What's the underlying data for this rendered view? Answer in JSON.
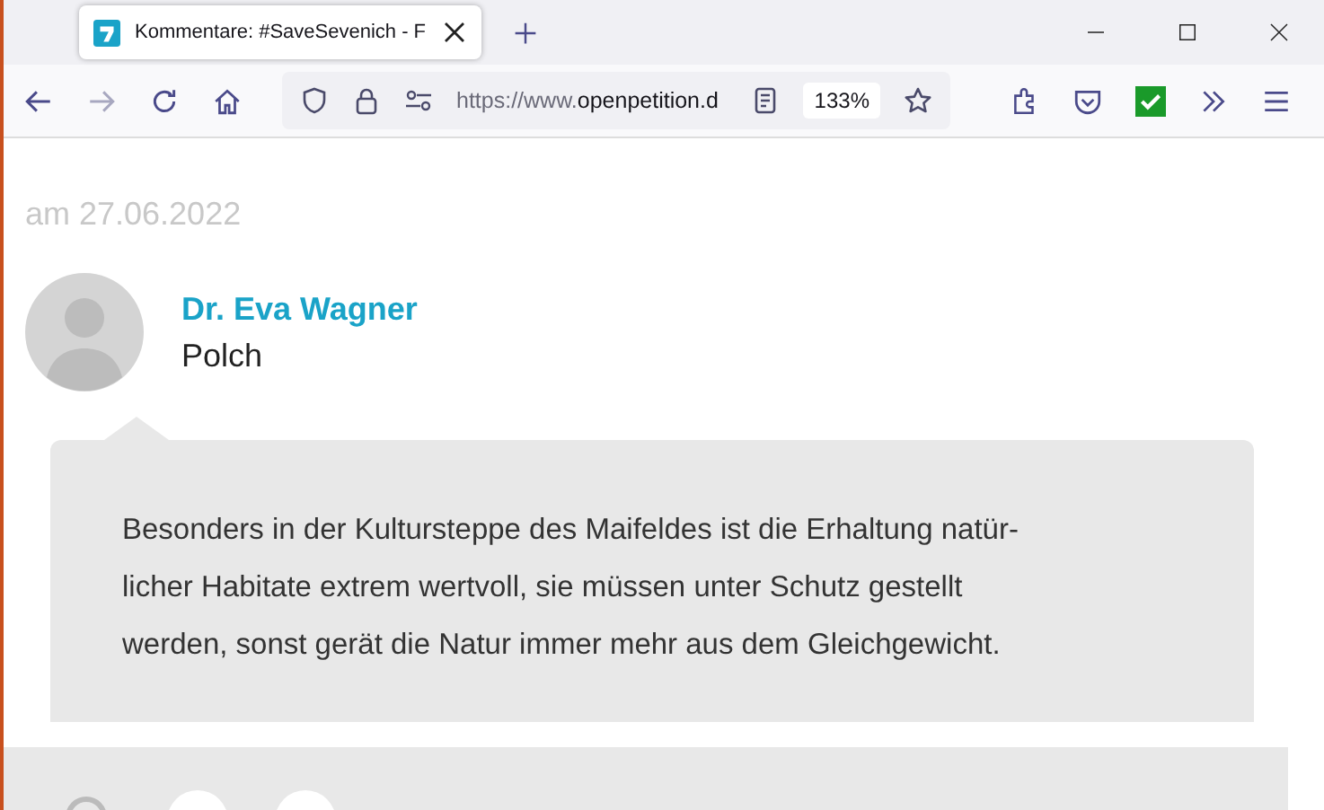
{
  "tab": {
    "title": "Kommentare: #SaveSevenich - F",
    "selected": true
  },
  "nav": [
    {
      "kind": "back",
      "disabled": false
    },
    {
      "kind": "forward",
      "disabled": true
    },
    {
      "kind": "reload",
      "disabled": false
    },
    {
      "kind": "home",
      "disabled": false
    }
  ],
  "address": {
    "scheme": "https://www.",
    "host": "openpetition.d",
    "zoom": "133%"
  },
  "comment": {
    "date": "am 27.06.2022",
    "author": "Dr. Eva Wagner",
    "place": "Polch",
    "lines": [
      "Besonders in der Kultursteppe des Maifeldes ist die Erhaltung natür-",
      "licher Habitate extrem wertvoll, sie müssen unter Schutz gestellt",
      "werden, sonst gerät die Natur immer mehr aus dem Gleichgewicht."
    ]
  }
}
